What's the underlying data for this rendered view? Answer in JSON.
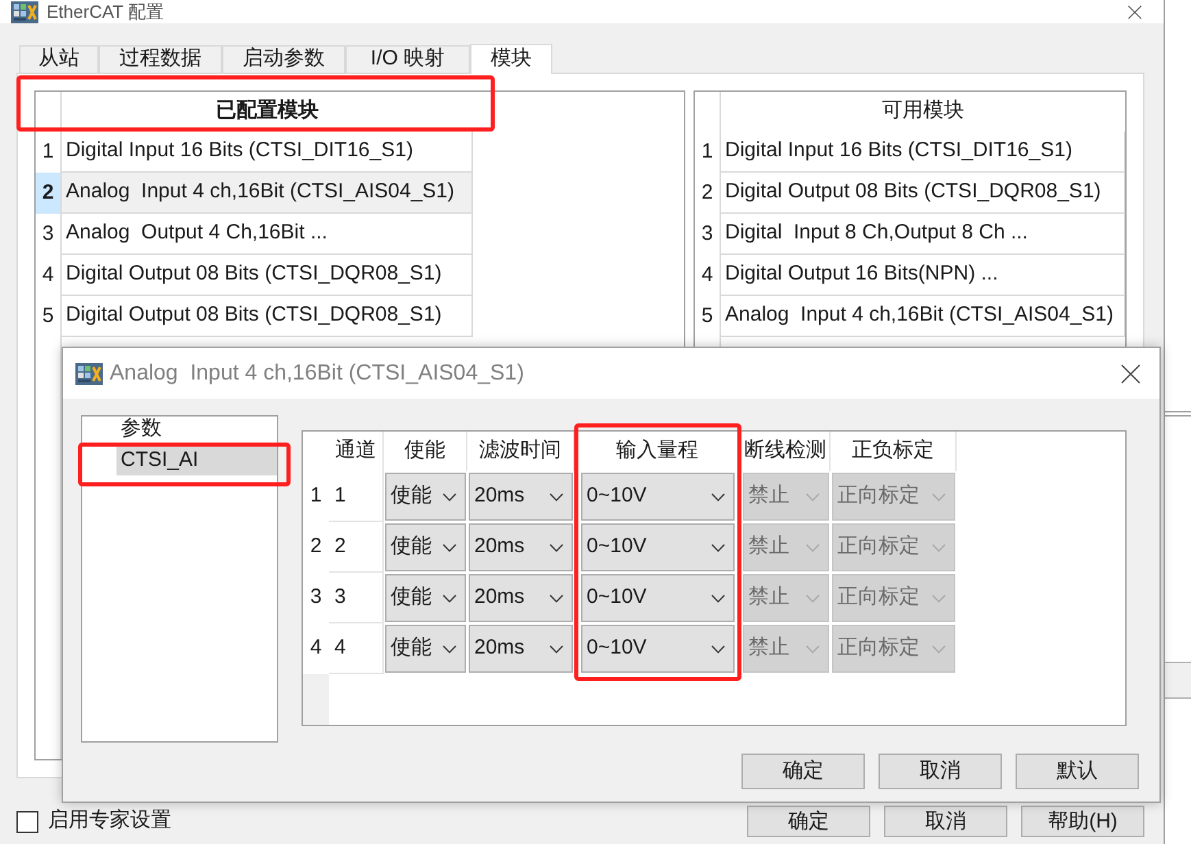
{
  "main_window": {
    "title": "EtherCAT 配置"
  },
  "tabs": [
    {
      "label": "从站",
      "selected": false
    },
    {
      "label": "过程数据",
      "selected": false
    },
    {
      "label": "启动参数",
      "selected": false
    },
    {
      "label": "I/O 映射",
      "selected": false
    },
    {
      "label": "模块",
      "selected": true
    }
  ],
  "configured_modules": {
    "header": "已配置模块",
    "rows": [
      {
        "index": "1",
        "name": "Digital Input 16 Bits (CTSI_DIT16_S1)",
        "selected": false
      },
      {
        "index": "2",
        "name": "Analog  Input 4 ch,16Bit (CTSI_AIS04_S1)",
        "selected": true
      },
      {
        "index": "3",
        "name": "Analog  Output 4 Ch,16Bit ...",
        "selected": false
      },
      {
        "index": "4",
        "name": "Digital Output 08 Bits (CTSI_DQR08_S1)",
        "selected": false
      },
      {
        "index": "5",
        "name": "Digital Output 08 Bits (CTSI_DQR08_S1)",
        "selected": false
      }
    ]
  },
  "available_modules": {
    "header": "可用模块",
    "rows": [
      {
        "index": "1",
        "name": "Digital Input 16 Bits (CTSI_DIT16_S1)",
        "selected": false
      },
      {
        "index": "2",
        "name": "Digital Output 08 Bits (CTSI_DQR08_S1)",
        "selected": false
      },
      {
        "index": "3",
        "name": "Digital  Input 8 Ch,Output 8 Ch ...",
        "selected": false
      },
      {
        "index": "4",
        "name": "Digital Output 16 Bits(NPN) ...",
        "selected": false
      },
      {
        "index": "5",
        "name": "Analog  Input 4 ch,16Bit (CTSI_AIS04_S1)",
        "selected": false
      }
    ]
  },
  "expert_setting": {
    "label": "启用专家设置",
    "checked": false
  },
  "buttons": [
    "确定",
    "取消",
    "帮助(H)"
  ],
  "dialog": {
    "title": "Analog  Input 4 ch,16Bit (CTSI_AIS04_S1)",
    "tree": [
      {
        "label": "参数",
        "selected": false,
        "children": [
          {
            "label": "CTSI_AI",
            "selected": true
          }
        ]
      }
    ],
    "grid": {
      "columns": [
        "通道",
        "使能",
        "滤波时间",
        "输入量程",
        "断线检测",
        "正负标定"
      ],
      "rows": [
        {
          "index": "1",
          "cells": [
            {
              "kind": "text",
              "value": "1"
            },
            {
              "kind": "combo",
              "value": "使能",
              "disabled": false
            },
            {
              "kind": "combo",
              "value": "20ms",
              "disabled": false
            },
            {
              "kind": "combo",
              "value": "0~10V",
              "disabled": false
            },
            {
              "kind": "combo",
              "value": "禁止",
              "disabled": true
            },
            {
              "kind": "combo",
              "value": "正向标定",
              "disabled": true
            }
          ]
        },
        {
          "index": "2",
          "cells": [
            {
              "kind": "text",
              "value": "2"
            },
            {
              "kind": "combo",
              "value": "使能",
              "disabled": false
            },
            {
              "kind": "combo",
              "value": "20ms",
              "disabled": false
            },
            {
              "kind": "combo",
              "value": "0~10V",
              "disabled": false
            },
            {
              "kind": "combo",
              "value": "禁止",
              "disabled": true
            },
            {
              "kind": "combo",
              "value": "正向标定",
              "disabled": true
            }
          ]
        },
        {
          "index": "3",
          "cells": [
            {
              "kind": "text",
              "value": "3"
            },
            {
              "kind": "combo",
              "value": "使能",
              "disabled": false
            },
            {
              "kind": "combo",
              "value": "20ms",
              "disabled": false
            },
            {
              "kind": "combo",
              "value": "0~10V",
              "disabled": false
            },
            {
              "kind": "combo",
              "value": "禁止",
              "disabled": true
            },
            {
              "kind": "combo",
              "value": "正向标定",
              "disabled": true
            }
          ]
        },
        {
          "index": "4",
          "cells": [
            {
              "kind": "text",
              "value": "4"
            },
            {
              "kind": "combo",
              "value": "使能",
              "disabled": false
            },
            {
              "kind": "combo",
              "value": "20ms",
              "disabled": false
            },
            {
              "kind": "combo",
              "value": "0~10V",
              "disabled": false
            },
            {
              "kind": "combo",
              "value": "禁止",
              "disabled": true
            },
            {
              "kind": "combo",
              "value": "正向标定",
              "disabled": true
            }
          ]
        }
      ]
    },
    "buttons": [
      "确定",
      "取消",
      "默认"
    ]
  }
}
